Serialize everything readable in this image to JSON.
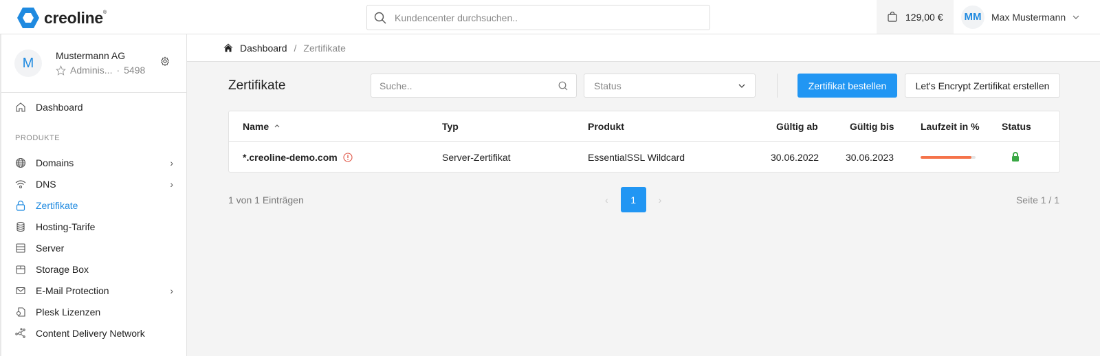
{
  "app": {
    "logo_text": "creoline",
    "brand_color": "#1f8ae0"
  },
  "header": {
    "search_placeholder": "Kundencenter durchsuchen..",
    "cart_amount": "129,00 €",
    "user_initials": "MM",
    "user_name": "Max Mustermann"
  },
  "account": {
    "initial": "M",
    "name": "Mustermann AG",
    "role": "Adminis...",
    "separator": "·",
    "number": "5498"
  },
  "sidebar": {
    "dashboard": "Dashboard",
    "section_label": "PRODUKTE",
    "items": [
      {
        "label": "Domains",
        "icon": "globe-icon",
        "has_submenu": true
      },
      {
        "label": "DNS",
        "icon": "wifi-icon",
        "has_submenu": true
      },
      {
        "label": "Zertifikate",
        "icon": "lock-icon",
        "active": true
      },
      {
        "label": "Hosting-Tarife",
        "icon": "database-icon"
      },
      {
        "label": "Server",
        "icon": "server-icon"
      },
      {
        "label": "Storage Box",
        "icon": "box-icon"
      },
      {
        "label": "E-Mail Protection",
        "icon": "mail-icon",
        "has_submenu": true
      },
      {
        "label": "Plesk Lizenzen",
        "icon": "license-icon"
      },
      {
        "label": "Content Delivery Network",
        "icon": "network-icon"
      }
    ]
  },
  "breadcrumb": {
    "home": "Dashboard",
    "separator": "/",
    "current": "Zertifikate"
  },
  "page": {
    "title": "Zertifikate",
    "search_placeholder": "Suche..",
    "status_placeholder": "Status",
    "order_button": "Zertifikat bestellen",
    "letsencrypt_button": "Let's Encrypt Zertifikat erstellen"
  },
  "table": {
    "columns": [
      "Name",
      "Typ",
      "Produkt",
      "Gültig ab",
      "Gültig bis",
      "Laufzeit in %",
      "Status"
    ],
    "sort_indicator": "^",
    "rows": [
      {
        "name": "*.creoline-demo.com",
        "warning": true,
        "type": "Server-Zertifikat",
        "product": "EssentialSSL Wildcard",
        "valid_from": "30.06.2022",
        "valid_to": "30.06.2023",
        "runtime_percent": 92,
        "status": "secure"
      }
    ]
  },
  "footer": {
    "entries": "1 von 1 Einträgen",
    "current_page": "1",
    "page_info": "Seite 1 / 1"
  }
}
